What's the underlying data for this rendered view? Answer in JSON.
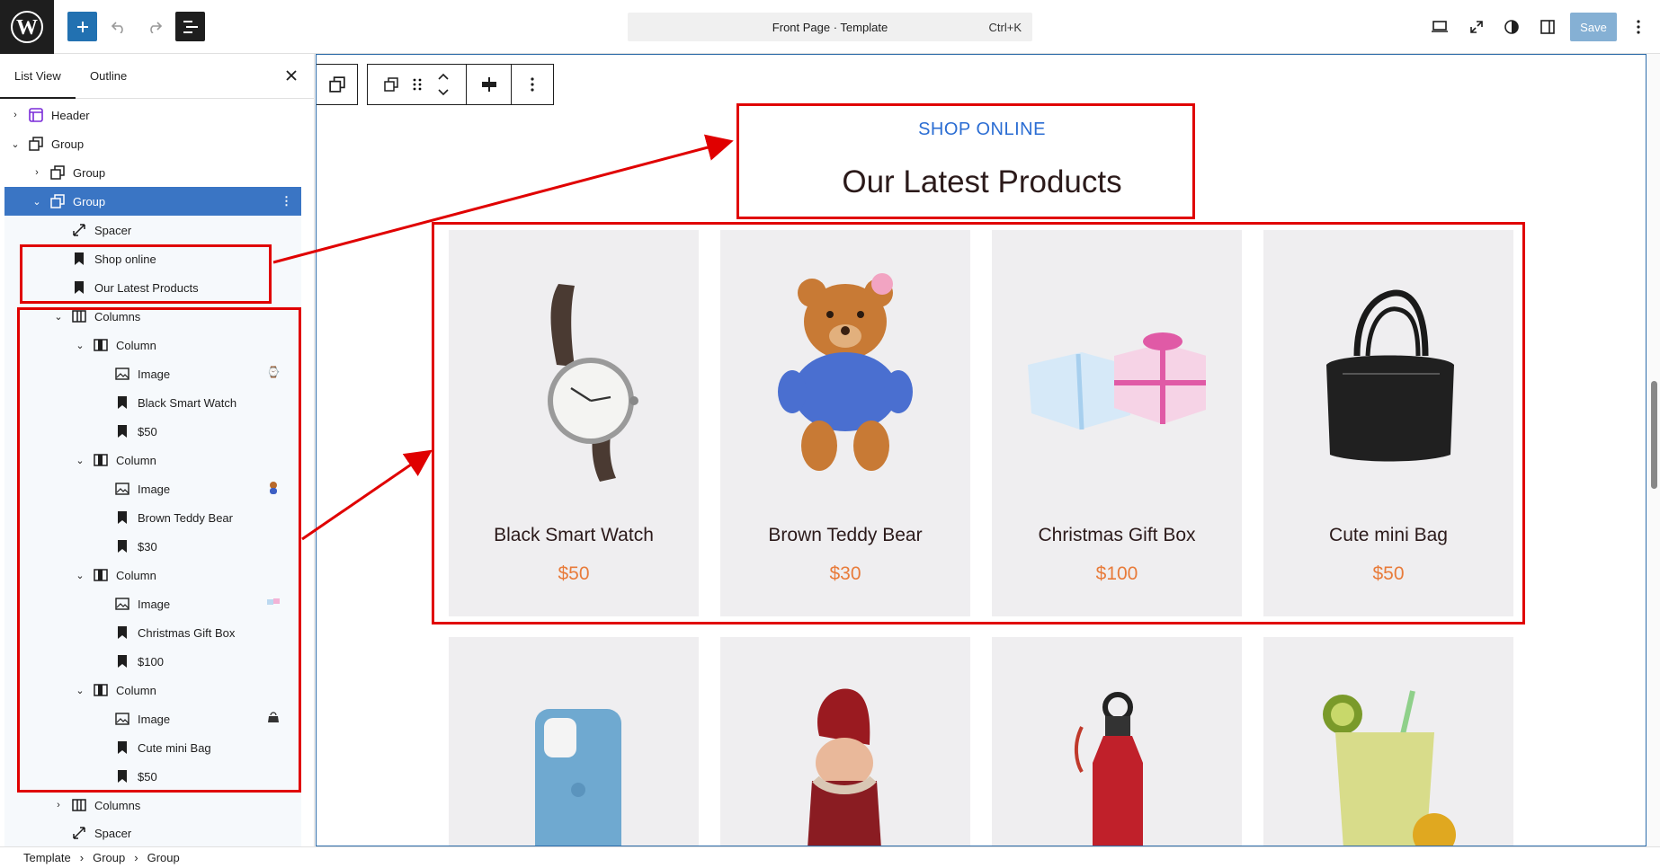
{
  "topbar": {
    "command_label": "Front Page · Template",
    "command_shortcut": "Ctrl+K",
    "save_label": "Save"
  },
  "sidebar": {
    "tabs": [
      "List View",
      "Outline"
    ],
    "rows": [
      {
        "label": "Header"
      },
      {
        "label": "Group"
      },
      {
        "label": "Group"
      },
      {
        "label": "Group"
      },
      {
        "label": "Spacer"
      },
      {
        "label": "Shop online"
      },
      {
        "label": "Our Latest Products"
      },
      {
        "label": "Columns"
      },
      {
        "label": "Column"
      },
      {
        "label": "Image"
      },
      {
        "label": "Black Smart Watch"
      },
      {
        "label": "$50"
      },
      {
        "label": "Column"
      },
      {
        "label": "Image"
      },
      {
        "label": "Brown Teddy Bear"
      },
      {
        "label": "$30"
      },
      {
        "label": "Column"
      },
      {
        "label": "Image"
      },
      {
        "label": "Christmas Gift Box"
      },
      {
        "label": "$100"
      },
      {
        "label": "Column"
      },
      {
        "label": "Image"
      },
      {
        "label": "Cute mini Bag"
      },
      {
        "label": "$50"
      },
      {
        "label": "Columns"
      },
      {
        "label": "Spacer"
      }
    ]
  },
  "breadcrumb": [
    "Template",
    "Group",
    "Group"
  ],
  "page": {
    "subtitle": "SHOP ONLINE",
    "title": "Our Latest Products",
    "products": [
      {
        "name": "Black Smart Watch",
        "price": "$50"
      },
      {
        "name": "Brown Teddy Bear",
        "price": "$30"
      },
      {
        "name": "Christmas Gift Box",
        "price": "$100"
      },
      {
        "name": "Cute mini Bag",
        "price": "$50"
      }
    ]
  },
  "colors": {
    "accent": "#2271b1",
    "selection": "#3a75c4",
    "subtitle": "#2b6dd3",
    "price": "#e87b3a",
    "annotation": "#e00000"
  }
}
